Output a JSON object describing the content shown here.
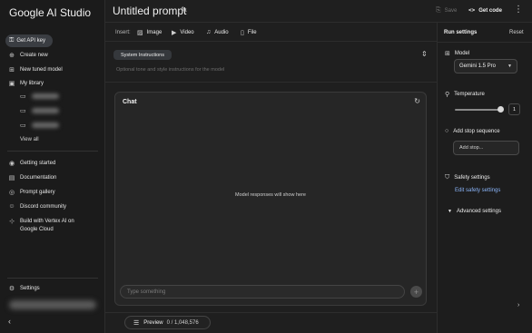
{
  "app": {
    "brand": "Google AI Studio"
  },
  "sidebar": {
    "api_key": "Get API key",
    "items": [
      {
        "label": "Create new",
        "icon": "plus-circle-icon",
        "glyph": "⊕"
      },
      {
        "label": "New tuned model",
        "icon": "tune-icon",
        "glyph": "⊞"
      },
      {
        "label": "My library",
        "icon": "library-icon",
        "glyph": "▣"
      }
    ],
    "view_all": "View all",
    "links": [
      {
        "label": "Getting started",
        "icon": "rocket-icon",
        "glyph": "◉"
      },
      {
        "label": "Documentation",
        "icon": "doc-icon",
        "glyph": "▤"
      },
      {
        "label": "Prompt gallery",
        "icon": "gallery-icon",
        "glyph": "◎"
      },
      {
        "label": "Discord community",
        "icon": "discord-icon",
        "glyph": "☺"
      },
      {
        "label": "Build with Vertex AI on",
        "label2": "Google Cloud",
        "icon": "vertex-icon",
        "glyph": "⊹"
      }
    ],
    "settings": "Settings"
  },
  "topbar": {
    "title": "Untitled prompt",
    "save": "Save",
    "get_code": "Get code"
  },
  "insert": {
    "label": "Insert:",
    "items": [
      {
        "label": "Image",
        "icon": "image-icon",
        "glyph": "▨"
      },
      {
        "label": "Video",
        "icon": "video-icon",
        "glyph": "▶"
      },
      {
        "label": "Audio",
        "icon": "audio-icon",
        "glyph": "♫"
      },
      {
        "label": "File",
        "icon": "file-icon",
        "glyph": "▯"
      }
    ]
  },
  "system": {
    "label": "System Instructions",
    "placeholder": "Optional tone and style instructions for the model"
  },
  "chat": {
    "title": "Chat",
    "empty": "Model responses will show here",
    "input_placeholder": "Type something"
  },
  "preview": {
    "label": "Preview",
    "tokens": "0 / 1,048,576"
  },
  "run_settings": {
    "title": "Run settings",
    "reset": "Reset",
    "model_label": "Model",
    "model_value": "Gemini 1.5 Pro",
    "temperature_label": "Temperature",
    "temperature_value": "1",
    "temperature_fraction": 1.0,
    "stop_label": "Add stop sequence",
    "stop_placeholder": "Add stop...",
    "safety_label": "Safety settings",
    "safety_link": "Edit safety settings",
    "advanced": "Advanced settings"
  },
  "colors": {
    "link": "#8ab4f8",
    "background": "#1f1f1f"
  }
}
